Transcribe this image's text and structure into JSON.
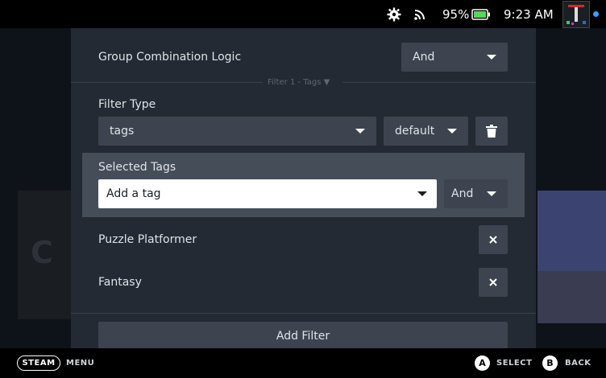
{
  "status_bar": {
    "battery_percent": "95%",
    "time": "9:23 AM",
    "icons": [
      "gear-icon",
      "wifi-icon",
      "battery-icon"
    ]
  },
  "panel": {
    "group_logic": {
      "label": "Group Combination Logic",
      "value": "And"
    },
    "filter_divider": {
      "label": "Filter 1 - Tags"
    },
    "filter_type": {
      "label": "Filter Type",
      "type_value": "tags",
      "mode_value": "default"
    },
    "selected_tags": {
      "label": "Selected Tags",
      "input_value": "Add a tag",
      "logic_value": "And",
      "tags": [
        {
          "name": "Puzzle Platformer"
        },
        {
          "name": "Fantasy"
        }
      ]
    },
    "add_filter_label": "Add Filter"
  },
  "bottom_bar": {
    "steam_label": "STEAM",
    "menu_label": "MENU",
    "a_glyph": "A",
    "select_label": "SELECT",
    "b_glyph": "B",
    "back_label": "BACK"
  },
  "colors": {
    "panel_bg": "#232a33",
    "control_bg": "#3d4450",
    "selected_section_bg": "#454d58",
    "text": "#dfe3e8"
  }
}
